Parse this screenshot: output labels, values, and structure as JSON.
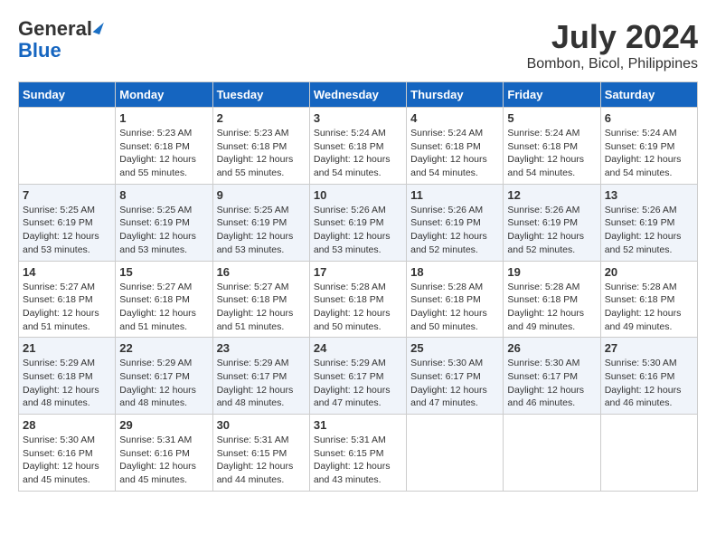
{
  "header": {
    "logo_line1": "General",
    "logo_line2": "Blue",
    "title": "July 2024",
    "subtitle": "Bombon, Bicol, Philippines"
  },
  "calendar": {
    "columns": [
      "Sunday",
      "Monday",
      "Tuesday",
      "Wednesday",
      "Thursday",
      "Friday",
      "Saturday"
    ],
    "weeks": [
      [
        {
          "day": "",
          "info": ""
        },
        {
          "day": "1",
          "info": "Sunrise: 5:23 AM\nSunset: 6:18 PM\nDaylight: 12 hours\nand 55 minutes."
        },
        {
          "day": "2",
          "info": "Sunrise: 5:23 AM\nSunset: 6:18 PM\nDaylight: 12 hours\nand 55 minutes."
        },
        {
          "day": "3",
          "info": "Sunrise: 5:24 AM\nSunset: 6:18 PM\nDaylight: 12 hours\nand 54 minutes."
        },
        {
          "day": "4",
          "info": "Sunrise: 5:24 AM\nSunset: 6:18 PM\nDaylight: 12 hours\nand 54 minutes."
        },
        {
          "day": "5",
          "info": "Sunrise: 5:24 AM\nSunset: 6:18 PM\nDaylight: 12 hours\nand 54 minutes."
        },
        {
          "day": "6",
          "info": "Sunrise: 5:24 AM\nSunset: 6:19 PM\nDaylight: 12 hours\nand 54 minutes."
        }
      ],
      [
        {
          "day": "7",
          "info": "Sunrise: 5:25 AM\nSunset: 6:19 PM\nDaylight: 12 hours\nand 53 minutes."
        },
        {
          "day": "8",
          "info": "Sunrise: 5:25 AM\nSunset: 6:19 PM\nDaylight: 12 hours\nand 53 minutes."
        },
        {
          "day": "9",
          "info": "Sunrise: 5:25 AM\nSunset: 6:19 PM\nDaylight: 12 hours\nand 53 minutes."
        },
        {
          "day": "10",
          "info": "Sunrise: 5:26 AM\nSunset: 6:19 PM\nDaylight: 12 hours\nand 53 minutes."
        },
        {
          "day": "11",
          "info": "Sunrise: 5:26 AM\nSunset: 6:19 PM\nDaylight: 12 hours\nand 52 minutes."
        },
        {
          "day": "12",
          "info": "Sunrise: 5:26 AM\nSunset: 6:19 PM\nDaylight: 12 hours\nand 52 minutes."
        },
        {
          "day": "13",
          "info": "Sunrise: 5:26 AM\nSunset: 6:19 PM\nDaylight: 12 hours\nand 52 minutes."
        }
      ],
      [
        {
          "day": "14",
          "info": "Sunrise: 5:27 AM\nSunset: 6:18 PM\nDaylight: 12 hours\nand 51 minutes."
        },
        {
          "day": "15",
          "info": "Sunrise: 5:27 AM\nSunset: 6:18 PM\nDaylight: 12 hours\nand 51 minutes."
        },
        {
          "day": "16",
          "info": "Sunrise: 5:27 AM\nSunset: 6:18 PM\nDaylight: 12 hours\nand 51 minutes."
        },
        {
          "day": "17",
          "info": "Sunrise: 5:28 AM\nSunset: 6:18 PM\nDaylight: 12 hours\nand 50 minutes."
        },
        {
          "day": "18",
          "info": "Sunrise: 5:28 AM\nSunset: 6:18 PM\nDaylight: 12 hours\nand 50 minutes."
        },
        {
          "day": "19",
          "info": "Sunrise: 5:28 AM\nSunset: 6:18 PM\nDaylight: 12 hours\nand 49 minutes."
        },
        {
          "day": "20",
          "info": "Sunrise: 5:28 AM\nSunset: 6:18 PM\nDaylight: 12 hours\nand 49 minutes."
        }
      ],
      [
        {
          "day": "21",
          "info": "Sunrise: 5:29 AM\nSunset: 6:18 PM\nDaylight: 12 hours\nand 48 minutes."
        },
        {
          "day": "22",
          "info": "Sunrise: 5:29 AM\nSunset: 6:17 PM\nDaylight: 12 hours\nand 48 minutes."
        },
        {
          "day": "23",
          "info": "Sunrise: 5:29 AM\nSunset: 6:17 PM\nDaylight: 12 hours\nand 48 minutes."
        },
        {
          "day": "24",
          "info": "Sunrise: 5:29 AM\nSunset: 6:17 PM\nDaylight: 12 hours\nand 47 minutes."
        },
        {
          "day": "25",
          "info": "Sunrise: 5:30 AM\nSunset: 6:17 PM\nDaylight: 12 hours\nand 47 minutes."
        },
        {
          "day": "26",
          "info": "Sunrise: 5:30 AM\nSunset: 6:17 PM\nDaylight: 12 hours\nand 46 minutes."
        },
        {
          "day": "27",
          "info": "Sunrise: 5:30 AM\nSunset: 6:16 PM\nDaylight: 12 hours\nand 46 minutes."
        }
      ],
      [
        {
          "day": "28",
          "info": "Sunrise: 5:30 AM\nSunset: 6:16 PM\nDaylight: 12 hours\nand 45 minutes."
        },
        {
          "day": "29",
          "info": "Sunrise: 5:31 AM\nSunset: 6:16 PM\nDaylight: 12 hours\nand 45 minutes."
        },
        {
          "day": "30",
          "info": "Sunrise: 5:31 AM\nSunset: 6:15 PM\nDaylight: 12 hours\nand 44 minutes."
        },
        {
          "day": "31",
          "info": "Sunrise: 5:31 AM\nSunset: 6:15 PM\nDaylight: 12 hours\nand 43 minutes."
        },
        {
          "day": "",
          "info": ""
        },
        {
          "day": "",
          "info": ""
        },
        {
          "day": "",
          "info": ""
        }
      ]
    ]
  }
}
